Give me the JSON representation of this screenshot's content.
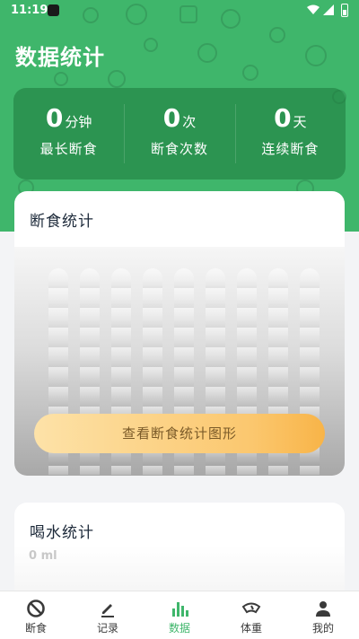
{
  "status_bar": {
    "time": "11:19"
  },
  "page_title": "数据统计",
  "summary": [
    {
      "value": "0",
      "unit": "分钟",
      "label": "最长断食"
    },
    {
      "value": "0",
      "unit": "次",
      "label": "断食次数"
    },
    {
      "value": "0",
      "unit": "天",
      "label": "连续断食"
    }
  ],
  "fasting_card": {
    "title": "断食统计",
    "button_label": "查看断食统计图形"
  },
  "water_card": {
    "title": "喝水统计",
    "value": "0 ml"
  },
  "nav": [
    {
      "label": "断食",
      "icon": "no-symbol-icon",
      "active": false
    },
    {
      "label": "记录",
      "icon": "pencil-icon",
      "active": false
    },
    {
      "label": "数据",
      "icon": "bar-chart-icon",
      "active": true
    },
    {
      "label": "体重",
      "icon": "scale-icon",
      "active": false
    },
    {
      "label": "我的",
      "icon": "person-icon",
      "active": false
    }
  ],
  "colors": {
    "brand_green": "#3fb66b",
    "button_gold": "#fbc76e"
  }
}
